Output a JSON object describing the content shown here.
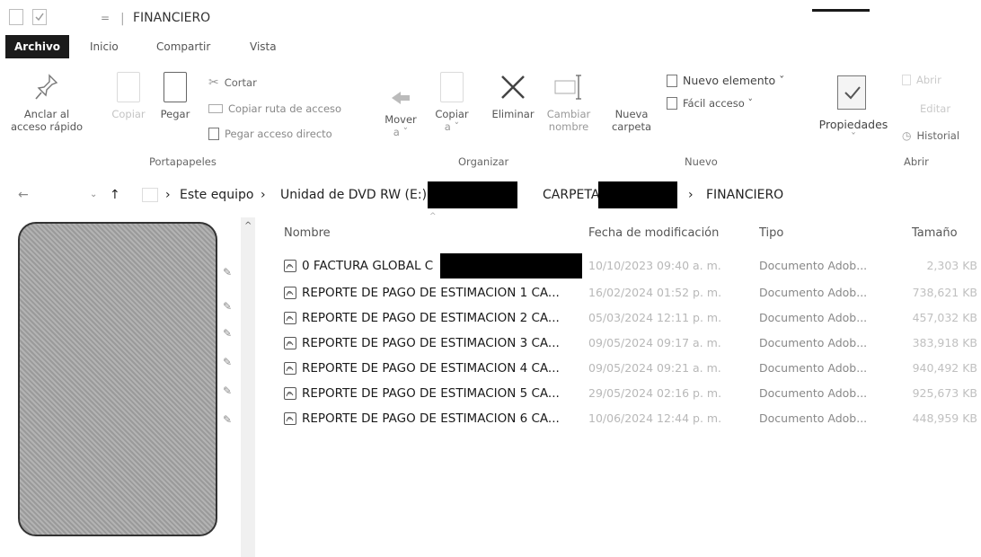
{
  "window": {
    "title": "FINANCIERO"
  },
  "ribbon": {
    "tabs": [
      "Archivo",
      "Inicio",
      "Compartir",
      "Vista"
    ],
    "portapapeles": {
      "pin_label_1": "Anclar al",
      "pin_label_2": "acceso rápido",
      "copy": "Copiar",
      "paste": "Pegar",
      "cut": "Cortar",
      "copy_path": "Copiar ruta de acceso",
      "paste_shortcut": "Pegar acceso directo",
      "label": "Portapapeles"
    },
    "organizar": {
      "move_1": "Mover",
      "move_2": "a ˇ",
      "copyto_1": "Copiar",
      "copyto_2": "a ˇ",
      "delete": "Eliminar",
      "rename_1": "Cambiar",
      "rename_2": "nombre",
      "label": "Organizar"
    },
    "nuevo": {
      "new_folder_1": "Nueva",
      "new_folder_2": "carpeta",
      "new_item": "Nuevo elemento ˇ",
      "easy_access": "Fácil acceso ˇ",
      "label": "Nuevo"
    },
    "abrir": {
      "properties": "Propiedades",
      "open": "Abrir",
      "edit": "Editar",
      "history": "Historial",
      "label": "Abrir"
    }
  },
  "address": {
    "seg1": "Este equipo",
    "seg2": "Unidad de DVD RW (E:)",
    "seg3": "CARPETA",
    "seg4": "FINANCIERO"
  },
  "columns": {
    "name": "Nombre",
    "modified": "Fecha de modificación",
    "type": "Tipo",
    "size": "Tamaño"
  },
  "files": [
    {
      "name": "0 FACTURA GLOBAL C",
      "modified": "10/10/2023 09:40 a. m.",
      "type": "Documento Adob...",
      "size": "2,303 KB"
    },
    {
      "name": "REPORTE DE PAGO DE ESTIMACION 1 CA...",
      "modified": "16/02/2024 01:52 p. m.",
      "type": "Documento Adob...",
      "size": "738,621 KB"
    },
    {
      "name": "REPORTE DE PAGO DE ESTIMACION 2 CA...",
      "modified": "05/03/2024 12:11 p. m.",
      "type": "Documento Adob...",
      "size": "457,032 KB"
    },
    {
      "name": "REPORTE DE PAGO DE ESTIMACION 3 CA...",
      "modified": "09/05/2024 09:17 a. m.",
      "type": "Documento Adob...",
      "size": "383,918 KB"
    },
    {
      "name": "REPORTE DE PAGO DE ESTIMACION 4 CA...",
      "modified": "09/05/2024 09:21 a. m.",
      "type": "Documento Adob...",
      "size": "940,492 KB"
    },
    {
      "name": "REPORTE DE PAGO DE ESTIMACION 5 CA...",
      "modified": "29/05/2024 02:16 p. m.",
      "type": "Documento Adob...",
      "size": "925,673 KB"
    },
    {
      "name": "REPORTE DE PAGO DE ESTIMACION 6 CA...",
      "modified": "10/06/2024 12:44 p. m.",
      "type": "Documento Adob...",
      "size": "448,959 KB"
    }
  ]
}
